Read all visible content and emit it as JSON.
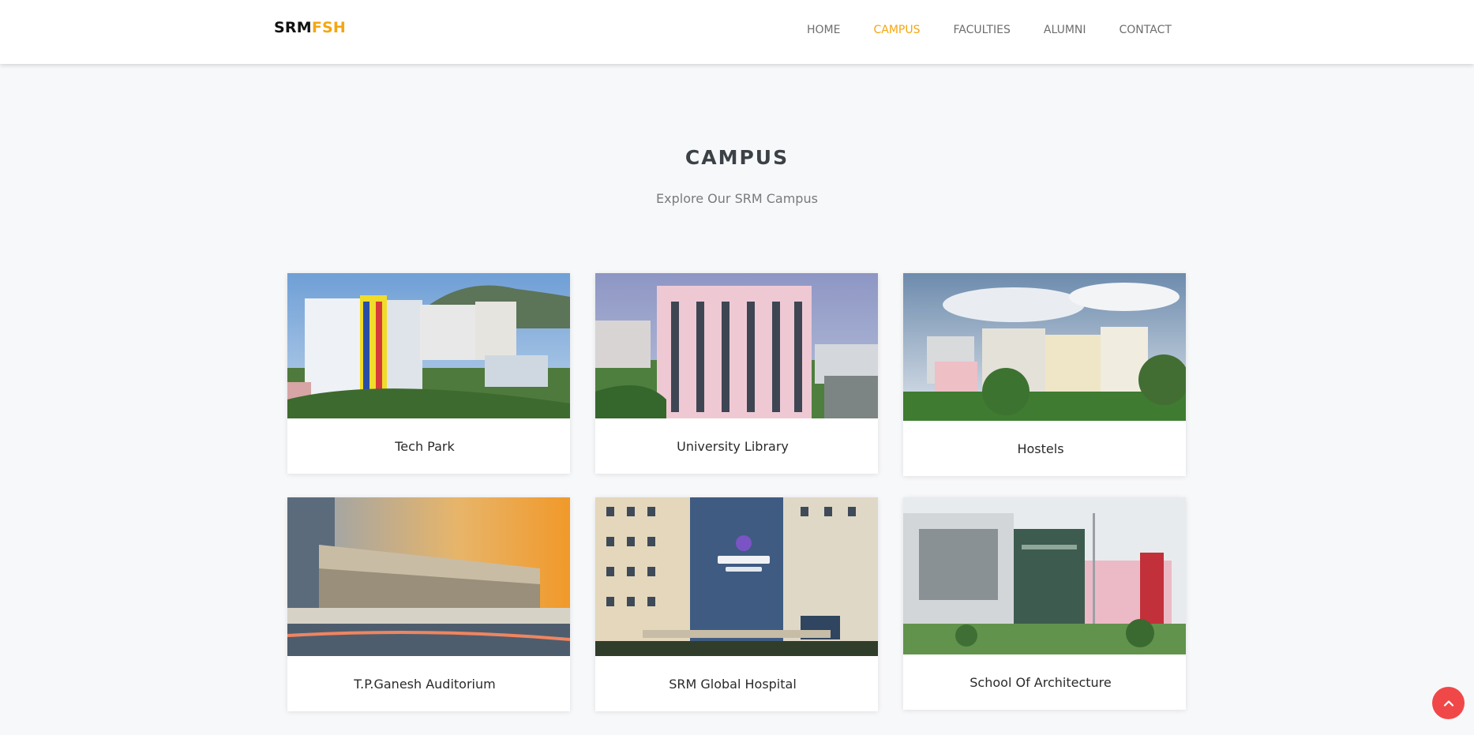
{
  "header": {
    "logo_part1": "SRM",
    "logo_part2": "FSH",
    "nav": [
      {
        "label": "HOME",
        "active": false
      },
      {
        "label": "CAMPUS",
        "active": true
      },
      {
        "label": "FACULTIES",
        "active": false
      },
      {
        "label": "ALUMNI",
        "active": false
      },
      {
        "label": "CONTACT",
        "active": false
      }
    ]
  },
  "section": {
    "title": "CAMPUS",
    "subtitle": "Explore Our SRM Campus"
  },
  "cards": [
    {
      "label": "Tech Park"
    },
    {
      "label": "University Library"
    },
    {
      "label": "Hostels"
    },
    {
      "label": "T.P.Ganesh Auditorium"
    },
    {
      "label": "SRM Global Hospital"
    },
    {
      "label": "School Of Architecture"
    }
  ],
  "back_to_top_icon": "chevron-up-icon",
  "colors": {
    "accent": "#f5a60f",
    "back_to_top": "#f04848"
  }
}
